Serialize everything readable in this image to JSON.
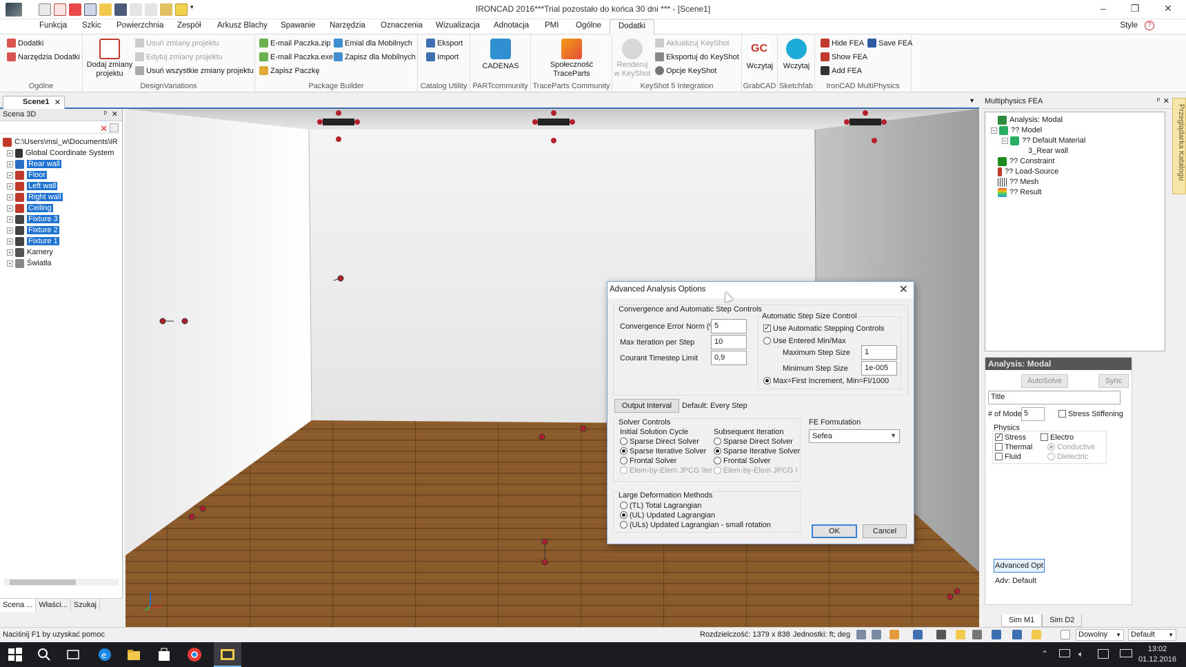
{
  "window": {
    "title": "IRONCAD 2016***Trial pozostało do końca 30 dni *** - [Scene1]",
    "style_label": "Style"
  },
  "menu_tabs": [
    "Funkcja",
    "Szkic",
    "Powierzchnia",
    "Zespół",
    "Arkusz Blachy",
    "Spawanie",
    "Narzędzia",
    "Oznaczenia",
    "Wizualizacja",
    "Adnotacja",
    "PMI",
    "Ogólne",
    "Dodatki"
  ],
  "active_tab": "Dodatki",
  "ribbon": {
    "ogolne": {
      "label": "Ogólne",
      "items": [
        "Dodatki",
        "Narzędzia Dodatki"
      ]
    },
    "designvariations": {
      "label": "DesignVariations",
      "big": "Dodaj zmiany projektu",
      "items": [
        "Usuń zmiany projektu",
        "Edytuj zmiany projektu",
        "Usuń wszystkie zmiany projektu"
      ]
    },
    "packagebuilder": {
      "label": "Package Builder",
      "items": [
        "E-mail Paczka.zip",
        "E-mail Paczka.exe",
        "Zapisz Paczkę",
        "Emial dla Mobilnych",
        "Zapisz dla Mobilnych"
      ]
    },
    "catalog": {
      "label": "Catalog Utility",
      "items": [
        "Eksport",
        "Import"
      ]
    },
    "partcommunity": {
      "label": "PARTcommunity",
      "big": "CADENAS"
    },
    "traceparts": {
      "label": "TraceParts Community",
      "big": "Społeczność TraceParts"
    },
    "keyshot": {
      "label": "KeyShot 5 Integration",
      "big": "Renderuj w KeyShot",
      "items": [
        "Aktualizuj KeyShot",
        "Eksportuj do KeyShot",
        "Opcje KeyShot"
      ]
    },
    "grabcad": {
      "label": "GrabCAD",
      "big": "Wczytaj"
    },
    "sketchfab": {
      "label": "Sketchfab",
      "big": "Wczytaj"
    },
    "multiphysics": {
      "label": "IronCAD MultiPhysics",
      "items": [
        "Hide FEA",
        "Show FEA",
        "Add FEA",
        "Save FEA"
      ]
    }
  },
  "doc_tab": "Scene1",
  "left_panel": {
    "title": "Scena 3D",
    "root": "C:\\Users\\msi_w\\Documents\\IR",
    "items": [
      {
        "label": "Global Coordinate System",
        "selected": false
      },
      {
        "label": "Rear wall",
        "selected": true
      },
      {
        "label": "Floor",
        "selected": true
      },
      {
        "label": "Left wall",
        "selected": true
      },
      {
        "label": "Right wall",
        "selected": true
      },
      {
        "label": "Ceiling",
        "selected": true
      },
      {
        "label": "Fixture 3",
        "selected": true
      },
      {
        "label": "Fixture 2",
        "selected": true
      },
      {
        "label": "Fixture 1",
        "selected": true
      },
      {
        "label": "Kamery",
        "selected": false
      },
      {
        "label": "Światła",
        "selected": false
      }
    ],
    "tabs": [
      "Scena ...",
      "Właści...",
      "Szukaj"
    ]
  },
  "right_panel": {
    "title": "Multiphysics FEA",
    "tree": [
      "Analysis: Modal",
      "?? Model",
      "?? Default Material",
      "3_Rear wall",
      "?? Constraint",
      "?? Load-Source",
      "?? Mesh",
      "?? Result"
    ],
    "analysis_header": "Analysis: Modal",
    "autosolve": "AutoSolve",
    "sync": "Sync",
    "title_field": "Title",
    "modes_label": "# of Modes",
    "modes_value": "5",
    "stress_stiffening": "Stress Stiffening",
    "physics_label": "Physics",
    "stress": "Stress",
    "thermal": "Thermal",
    "fluid": "Fluid",
    "electro": "Electro",
    "conductive": "Conductive",
    "dielectric": "Dielectric",
    "advanced_btn": "Advanced Opt",
    "adv_default": "Adv: Default",
    "sim_tabs": [
      "Sim M1",
      "Sim D2"
    ],
    "catalog_strip": "Przeglądarka Katalogu"
  },
  "dialog": {
    "title": "Advanced Analysis Options",
    "convergence_group": "Convergence and Automatic Step Controls",
    "conv_error_label": "Convergence Error Norm (%)",
    "conv_error_value": "5",
    "max_iter_label": "Max Iteration per Step",
    "max_iter_value": "10",
    "courant_label": "Courant Timestep Limit",
    "courant_value": "0,9",
    "auto_step_group": "Automatic Step Size Control",
    "use_auto": "Use Automatic Stepping Controls",
    "use_entered": "Use Entered Min/Max",
    "max_step_label": "Maximum Step Size",
    "max_step_value": "1",
    "min_step_label": "Minimum Step Size",
    "min_step_value": "1e-005",
    "max_first": "Max=First Increment, Min=FI/1000",
    "output_interval_btn": "Output Interval",
    "output_interval_default": "Default: Every Step",
    "solver_group": "Solver Controls",
    "initial_cycle": "Initial Solution Cycle",
    "subsequent": "Subsequent Iteration",
    "solvers_initial": [
      "Sparse Direct Solver",
      "Sparse Iterative Solver",
      "Frontal Solver",
      "Elem-by-Elem JPCG Iter"
    ],
    "solvers_subsequent": [
      "Sparse Direct Solver",
      "Sparse Iterative Solver",
      "Frontal Solver",
      "Elem-by-Elem JPCG I"
    ],
    "fe_formulation_label": "FE Formulation",
    "fe_formulation_value": "Sefea",
    "large_def_group": "Large Deformation Methods",
    "large_def": [
      "(TL) Total Lagrangian",
      "(UL) Updated Lagrangian",
      "(ULs) Updated Lagrangian - small rotation"
    ],
    "ok": "OK",
    "cancel": "Cancel"
  },
  "status": {
    "help": "Naciśnij F1 by uzyskać pomoc",
    "resolution": "Rozdzielczość: 1379 x 838",
    "units": "Jednostki: ft; deg",
    "mode": "Dowolny",
    "default": "Default"
  },
  "taskbar": {
    "time": "13:02",
    "date": "01.12.2016"
  },
  "colors": {
    "accent": "#1e73d2",
    "analysis_header": "#565656",
    "taskbar": "#1a1c20"
  }
}
